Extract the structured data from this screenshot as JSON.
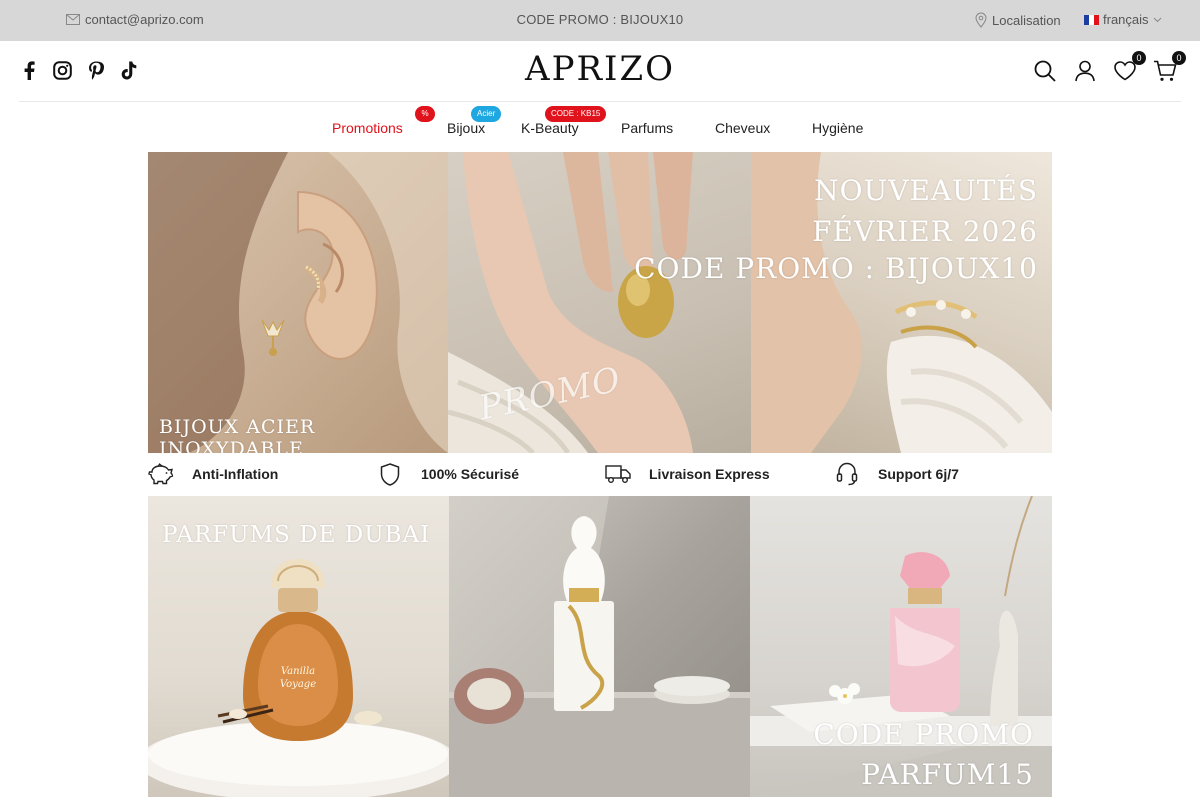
{
  "topbar": {
    "email": "contact@aprizo.com",
    "promo": "CODE PROMO : BIJOUX10",
    "location": "Localisation",
    "language": "français"
  },
  "header": {
    "logo": "APRIZO",
    "social": [
      "facebook-icon",
      "instagram-icon",
      "pinterest-icon",
      "tiktok-icon"
    ],
    "wishlist_count": "0",
    "cart_count": "0"
  },
  "nav": {
    "items": [
      {
        "label": "Promotions",
        "tag": "%"
      },
      {
        "label": "Bijoux",
        "tag": "Acier"
      },
      {
        "label": "K-Beauty",
        "tag": "CODE : KB15"
      },
      {
        "label": "Parfums"
      },
      {
        "label": "Cheveux"
      },
      {
        "label": "Hygiène"
      }
    ]
  },
  "banner1": {
    "left_text": "BIJOUX ACIER INOXYDABLE",
    "middle_text": "PROMO",
    "right_lines": [
      "NOUVEAUTÉS",
      "FÉVRIER 2026",
      "CODE PROMO : BIJOUX10"
    ]
  },
  "features": [
    {
      "label": "Anti-Inflation",
      "icon": "piggy-bank-icon"
    },
    {
      "label": "100% Sécurisé",
      "icon": "shield-icon"
    },
    {
      "label": "Livraison Express",
      "icon": "truck-icon"
    },
    {
      "label": "Support 6j/7",
      "icon": "headset-icon"
    }
  ],
  "banner2": {
    "left_text": "PARFUMS DE DUBAI",
    "bottle1_label": "Vanilla Voyage",
    "right_lines": [
      "CODE PROMO",
      "PARFUM15"
    ]
  },
  "colors": {
    "topbar_bg": "#d7d7d7",
    "accent_red": "#e0121b",
    "tag_blue": "#1ea7e0"
  }
}
